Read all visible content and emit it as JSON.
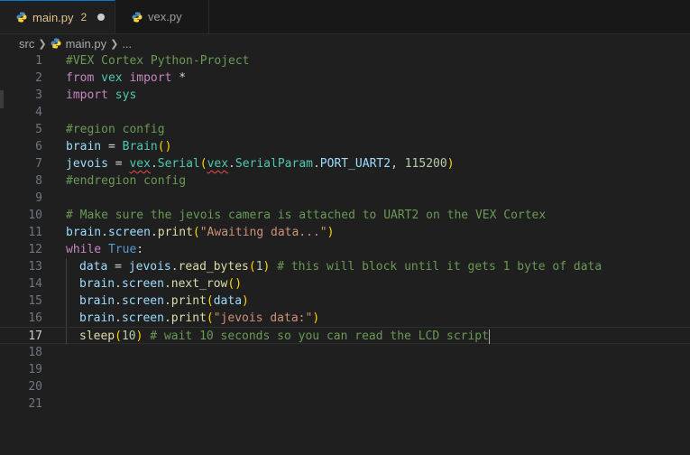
{
  "tabs": [
    {
      "label": "main.py",
      "badge": "2"
    },
    {
      "label": "vex.py"
    }
  ],
  "breadcrumb": {
    "folder": "src",
    "file": "main.py",
    "ellipsis": "..."
  },
  "colors": {
    "active_tab_text": "#e2c08d",
    "accent": "#0078d4",
    "python_icon_blue": "#4b8bbe",
    "python_icon_yellow": "#ffd43b"
  },
  "editor": {
    "current_line": "17",
    "lines": [
      {
        "n": "1",
        "t": [
          "#VEX Cortex Python-Project"
        ]
      },
      {
        "n": "2",
        "t": [
          "from",
          " ",
          "vex",
          " ",
          "import",
          " *"
        ]
      },
      {
        "n": "3",
        "t": [
          "import",
          " ",
          "sys"
        ]
      },
      {
        "n": "4",
        "t": []
      },
      {
        "n": "5",
        "t": [
          "#region config"
        ]
      },
      {
        "n": "6",
        "t": [
          "brain",
          " = ",
          "Brain",
          "(",
          ")"
        ]
      },
      {
        "n": "7",
        "t": [
          "jevois",
          " = ",
          "vex",
          ".",
          "Serial",
          "(",
          "vex",
          ".",
          "SerialParam",
          ".",
          "PORT_UART2",
          ", ",
          "115200",
          ")"
        ]
      },
      {
        "n": "8",
        "t": [
          "#endregion config"
        ]
      },
      {
        "n": "9",
        "t": []
      },
      {
        "n": "10",
        "t": [
          "# Make sure the jevois camera is attached to UART2 on the VEX Cortex"
        ]
      },
      {
        "n": "11",
        "t": [
          "brain",
          ".",
          "screen",
          ".",
          "print",
          "(",
          "\"Awaiting data...\"",
          ")"
        ]
      },
      {
        "n": "12",
        "t": [
          "while",
          " ",
          "True",
          ":"
        ]
      },
      {
        "n": "13",
        "t": [
          "data",
          " = ",
          "jevois",
          ".",
          "read_bytes",
          "(",
          "1",
          ") ",
          "# this will block until it gets 1 byte of data"
        ]
      },
      {
        "n": "14",
        "t": [
          "brain",
          ".",
          "screen",
          ".",
          "next_row",
          "(",
          ")"
        ]
      },
      {
        "n": "15",
        "t": [
          "brain",
          ".",
          "screen",
          ".",
          "print",
          "(",
          "data",
          ")"
        ]
      },
      {
        "n": "16",
        "t": [
          "brain",
          ".",
          "screen",
          ".",
          "print",
          "(",
          "\"jevois data:\"",
          ")"
        ]
      },
      {
        "n": "17",
        "t": [
          "sleep",
          "(",
          "10",
          ") ",
          "# wait 10 seconds so you can read the LCD script"
        ]
      },
      {
        "n": "18",
        "t": []
      },
      {
        "n": "19",
        "t": []
      },
      {
        "n": "20",
        "t": []
      },
      {
        "n": "21",
        "t": []
      }
    ]
  }
}
